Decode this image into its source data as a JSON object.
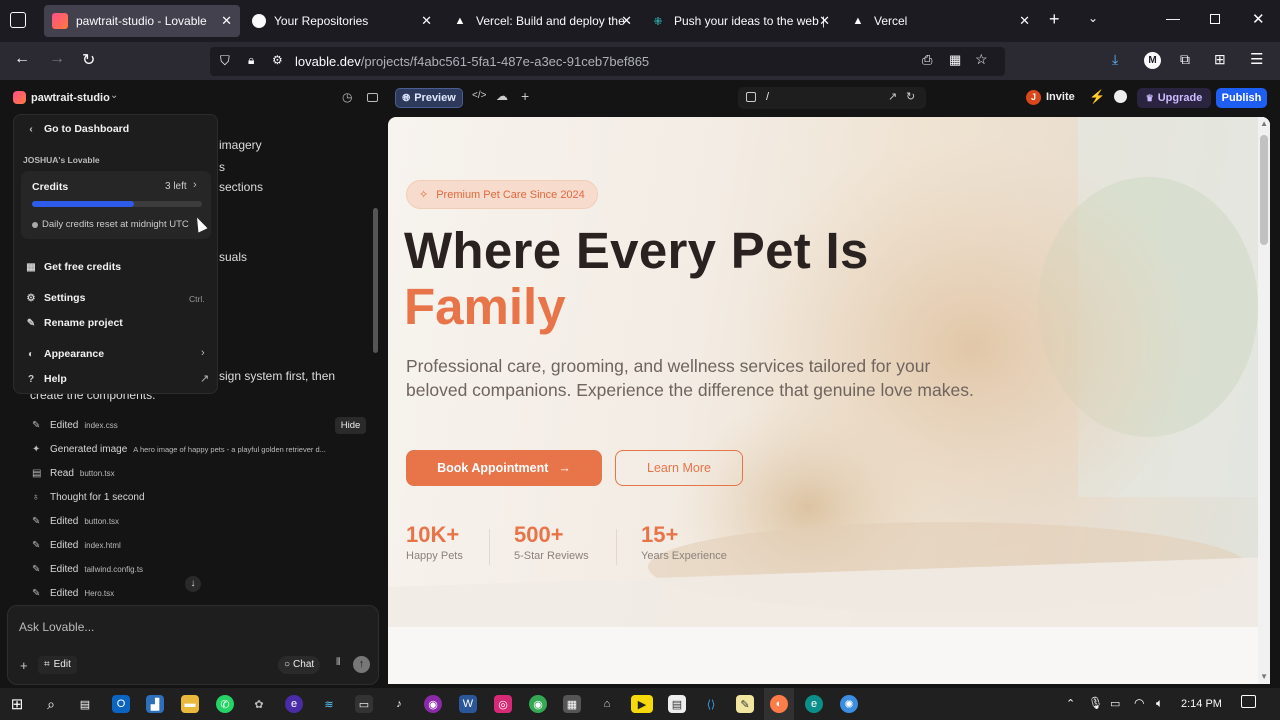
{
  "browser": {
    "tabs": [
      {
        "title": "pawtrait-studio - Lovable",
        "active": true
      },
      {
        "title": "Your Repositories"
      },
      {
        "title": "Vercel: Build and deploy the b"
      },
      {
        "title": "Push your ideas to the web | L"
      },
      {
        "title": "Vercel"
      }
    ],
    "url_host": "lovable.dev",
    "url_path": "/projects/f4abc561-5fa1-487e-a3ec-91ceb7bef865"
  },
  "lovable": {
    "project_name": "pawtrait-studio",
    "preview_label": "Preview",
    "path": "/",
    "invite": "Invite",
    "avatar_letter": "J",
    "upgrade": "Upgrade",
    "publish": "Publish"
  },
  "menu": {
    "back": "Go to Dashboard",
    "workspace": "JOSHUA's Lovable",
    "credits_label": "Credits",
    "credits_left": "3 left",
    "credits_fraction": 0.6,
    "reset_note": "Daily credits reset at midnight UTC",
    "free_credits": "Get free credits",
    "settings": "Settings",
    "settings_shortcut": "Ctrl.",
    "rename": "Rename project",
    "appearance": "Appearance",
    "help": "Help"
  },
  "chat": {
    "behind": [
      "imagery",
      "s",
      "sections",
      "suals"
    ],
    "message_tail": "sign system first, then",
    "message_line2": "create the components.",
    "hide": "Hide",
    "log": [
      {
        "action": "Edited",
        "detail": "index.css"
      },
      {
        "action": "Generated image",
        "detail": "A hero image of happy pets - a playful golden retriever d..."
      },
      {
        "action": "Read",
        "detail": "button.tsx"
      },
      {
        "action": "Thought for 1 second",
        "detail": ""
      },
      {
        "action": "Edited",
        "detail": "button.tsx"
      },
      {
        "action": "Edited",
        "detail": "index.html"
      },
      {
        "action": "Edited",
        "detail": "tailwind.config.ts"
      },
      {
        "action": "Edited",
        "detail": "Hero.tsx"
      }
    ],
    "input_placeholder": "Ask Lovable...",
    "edit": "Edit",
    "chat_mode": "Chat"
  },
  "site": {
    "badge": "Premium Pet Care Since 2024",
    "headline1": "Where Every Pet Is",
    "headline2": "Family",
    "subtitle": "Professional care, grooming, and wellness services tailored for your beloved companions. Experience the difference that genuine love makes.",
    "cta_primary": "Book Appointment",
    "cta_primary_arrow": "→",
    "cta_secondary": "Learn More",
    "stats": [
      {
        "value": "10K+",
        "label": "Happy Pets"
      },
      {
        "value": "500+",
        "label": "5-Star Reviews"
      },
      {
        "value": "15+",
        "label": "Years Experience"
      }
    ],
    "accent": "#e8744a"
  },
  "taskbar": {
    "time": "2:14 PM"
  }
}
